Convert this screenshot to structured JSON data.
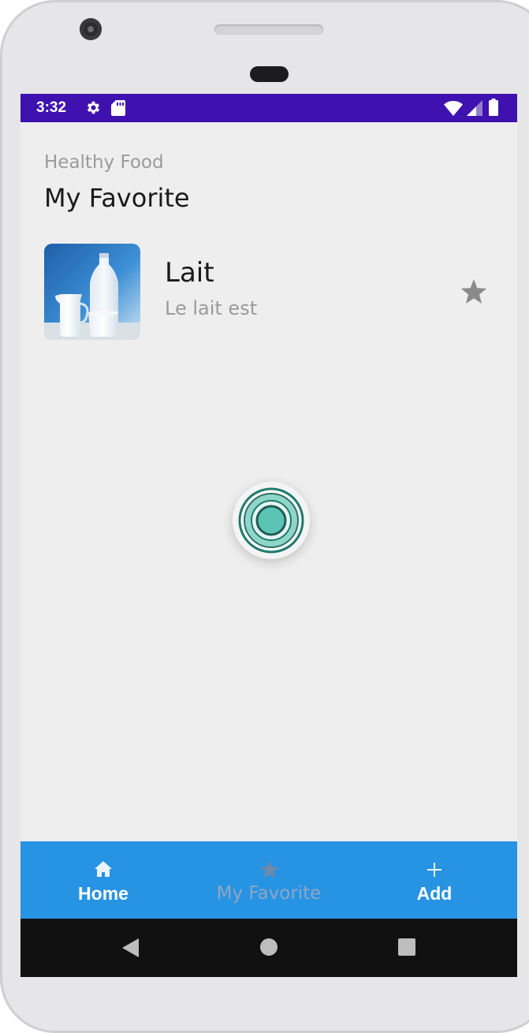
{
  "status_bar": {
    "time": "3:32",
    "background": "#3f12b0",
    "icons": [
      "gear-icon",
      "sd-card-icon",
      "wifi-icon",
      "signal-icon",
      "battery-icon"
    ]
  },
  "header": {
    "subtitle": "Healthy Food",
    "title": "My Favorite"
  },
  "favorites": [
    {
      "name": "Lait",
      "description": "Le lait est",
      "image": "milk-photo",
      "favorite_icon": "star-icon"
    }
  ],
  "loading_indicator": {
    "icon": "loading-spinner-icon",
    "color": "#5cc4b4"
  },
  "bottom_nav": {
    "background": "#2793e3",
    "tabs": [
      {
        "label": "Home",
        "icon": "home-icon",
        "active": true
      },
      {
        "label": "My Favorite",
        "icon": "star-icon",
        "active": false
      },
      {
        "label": "Add",
        "icon": "plus-icon",
        "active": true
      }
    ]
  },
  "system_nav": {
    "buttons": [
      "back-icon",
      "home-circle-icon",
      "recents-icon"
    ]
  }
}
